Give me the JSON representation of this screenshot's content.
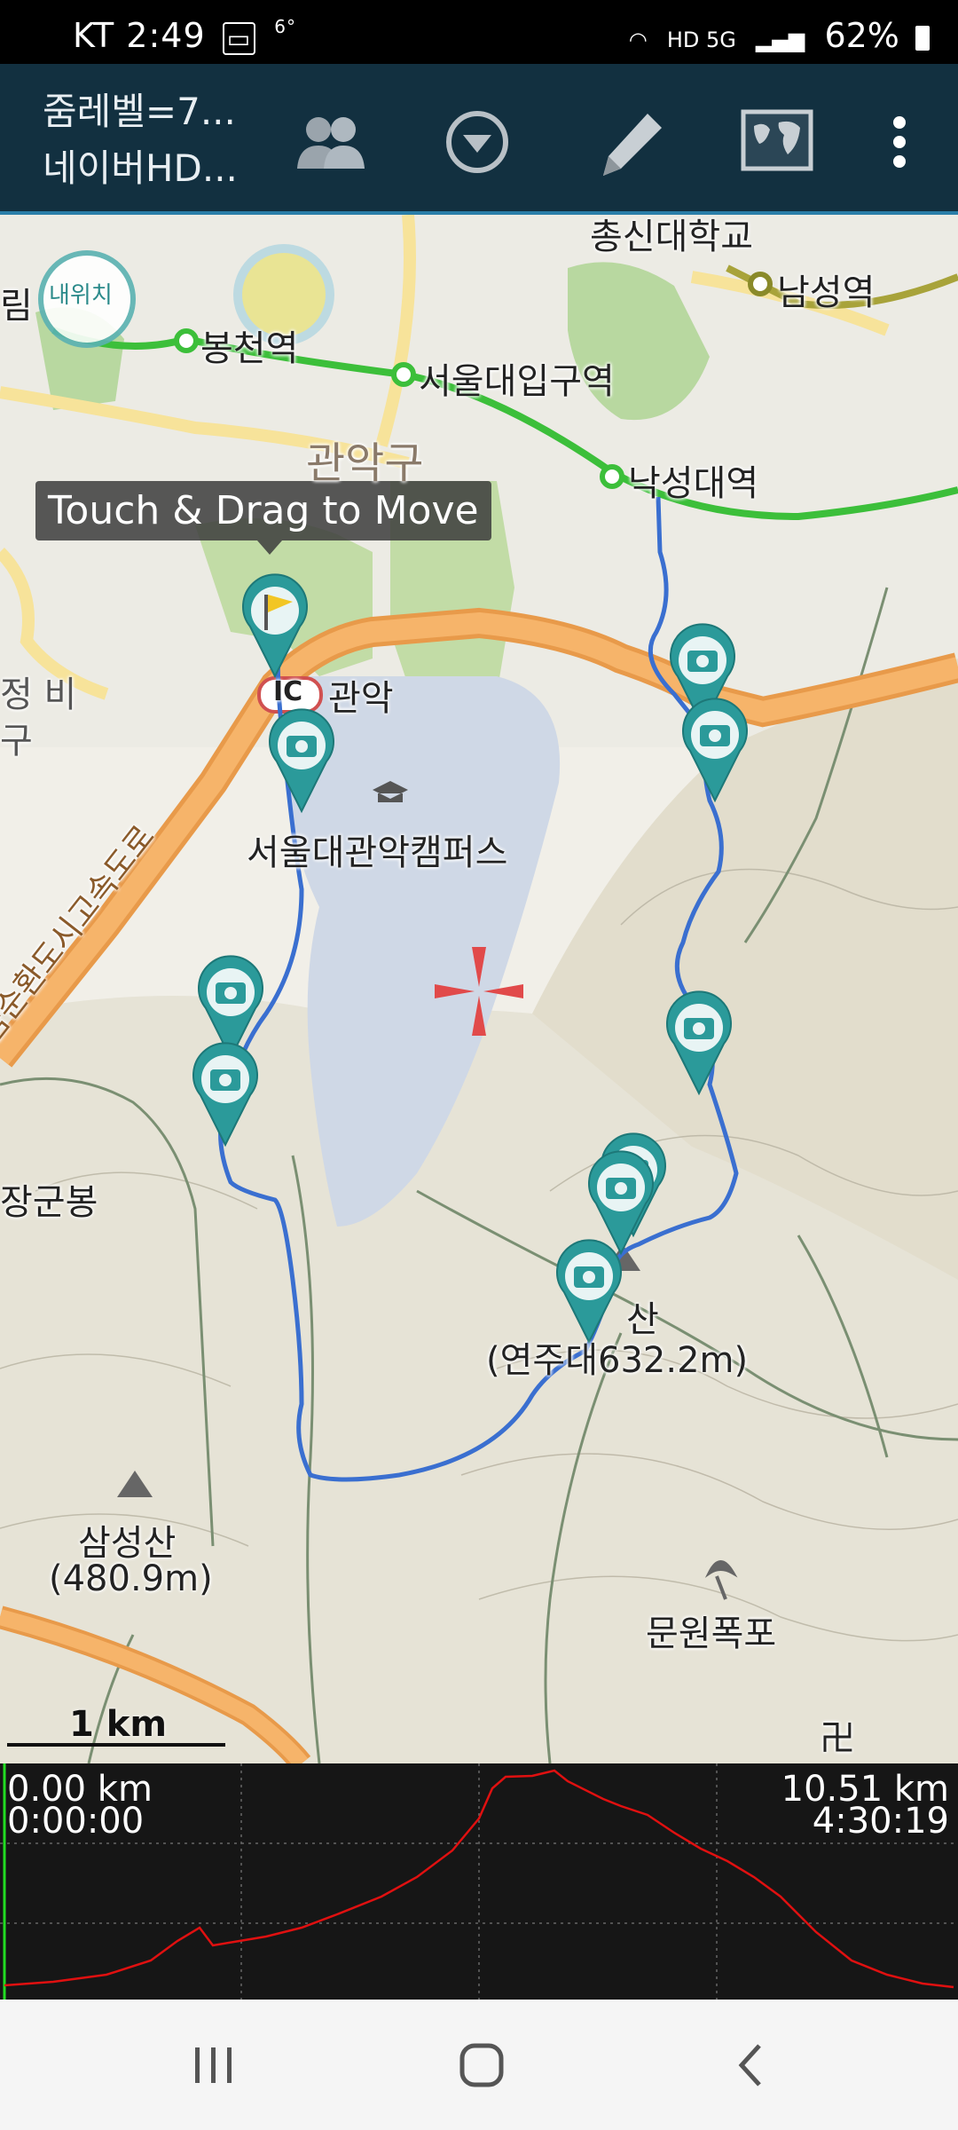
{
  "status_bar": {
    "carrier": "KT",
    "time": "2:49",
    "temp": "6°",
    "battery": "62%",
    "network_icons": "HD 5G"
  },
  "toolbar": {
    "title_line1": "줌레벨=7...",
    "title_line2": "네이버HD...",
    "buttons": [
      "people-icon",
      "dropdown-circle-icon",
      "pencil-icon",
      "world-map-icon",
      "more-vert-icon"
    ]
  },
  "map": {
    "tooltip": "Touch & Drag to Move",
    "my_location_label": "내위치",
    "labels": {
      "chongshin": "총신대학교",
      "namseong": "남성역",
      "rim": "림",
      "bongcheon": "봉천역",
      "seoulipgu": "서울대입구역",
      "gwanak_gu": "관악구",
      "nakseongdae": "낙성대역",
      "ic": "IC",
      "ic_gwanak": "관악",
      "jeongbi": "정 비",
      "gu": "구",
      "campus": "서울대관악캠퍼스",
      "expressway": "금순환도시고속도로",
      "janggunbong": "장군봉",
      "peak_name": "산",
      "peak_elev": "(연주대632.2m)",
      "samseongsan": "삼성산",
      "samseongsan_elev": "(480.9m)",
      "munwon": "문원폭포",
      "temple": "卍"
    },
    "scale_label": "1 km"
  },
  "profile": {
    "start_distance": "0.00 km",
    "start_time": "0:00:00",
    "end_distance": "10.51 km",
    "end_time": "4:30:19",
    "colors": {
      "line": "#e01010",
      "grid": "#777777",
      "cursor": "#22dd22"
    }
  },
  "nav": {
    "buttons": [
      "recent-apps-icon",
      "home-icon",
      "back-icon"
    ]
  },
  "colors": {
    "toolbar": "#123040",
    "route": "#3a6fd0",
    "marker": "#2b9a9a",
    "subway_green": "#3cbf3a",
    "highway_orange": "#f4a052"
  }
}
